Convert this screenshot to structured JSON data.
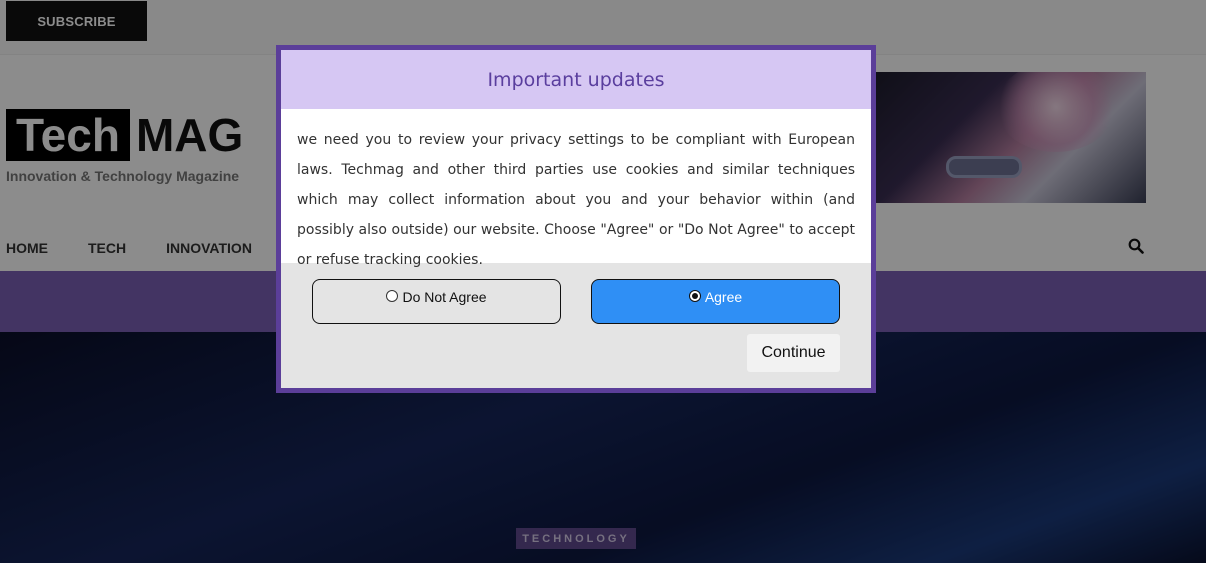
{
  "topbar": {
    "subscribe_label": "SUBSCRIBE"
  },
  "logo": {
    "part1": "Tech",
    "part2": "MAG",
    "tagline": "Innovation & Technology Magazine"
  },
  "nav": {
    "items": [
      "HOME",
      "TECH",
      "INNOVATION"
    ]
  },
  "hero": {
    "category_tag": "TECHNOLOGY"
  },
  "modal": {
    "title": "Important updates",
    "body": "we need you to review your privacy settings to be compliant with European laws. Techmag and other third parties use cookies and similar techniques which may collect information about you and your behavior within (and possibly also outside) our website. Choose \"Agree\" or \"Do Not Agree\" to accept or refuse tracking cookies.",
    "options": [
      {
        "label": "Do Not Agree",
        "selected": false
      },
      {
        "label": "Agree",
        "selected": true
      }
    ],
    "continue_label": "Continue",
    "colors": {
      "border": "#5b3e99",
      "header_bg": "#d6c7f3",
      "agree_bg": "#2f8ff5"
    }
  },
  "icons": {
    "search": "search-icon"
  }
}
